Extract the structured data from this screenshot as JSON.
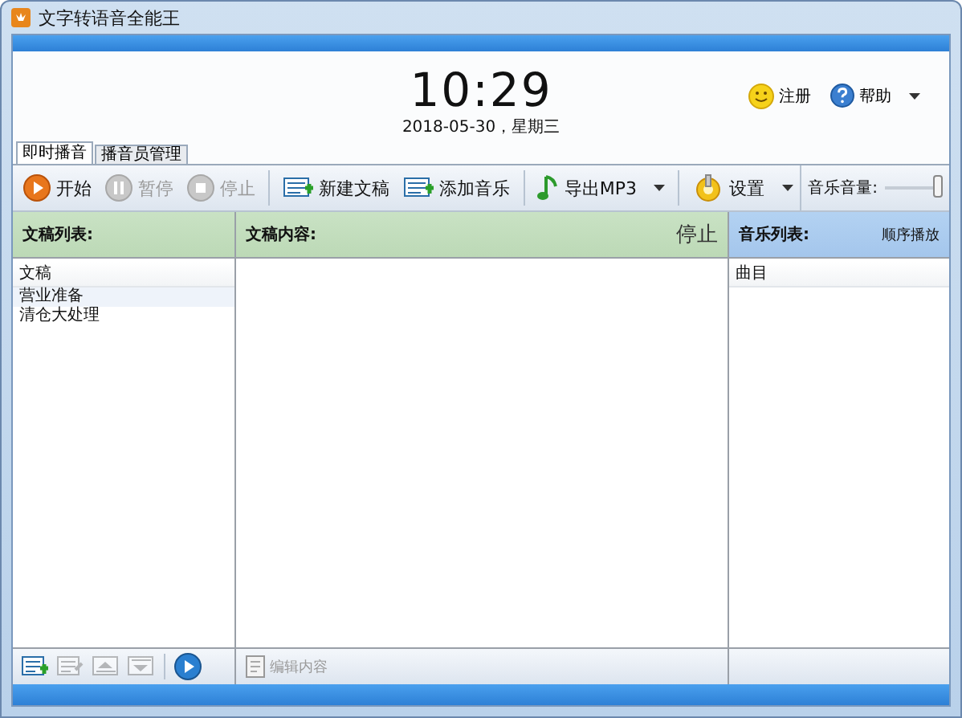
{
  "window": {
    "title": "文字转语音全能王"
  },
  "clock": {
    "time": "10:29",
    "date": "2018-05-30，星期三"
  },
  "header_links": [
    {
      "kind": "register",
      "label": "注册",
      "dropdown": false
    },
    {
      "kind": "help",
      "label": "帮助",
      "dropdown": true
    }
  ],
  "tabs": [
    {
      "label": "即时播音",
      "selected": true
    },
    {
      "label": "播音员管理",
      "selected": false
    }
  ],
  "toolbar": [
    {
      "kind": "play",
      "label": "开始",
      "disabled": false,
      "dropdown": false,
      "separator_before": false
    },
    {
      "kind": "pause",
      "label": "暂停",
      "disabled": true,
      "dropdown": false,
      "separator_before": false
    },
    {
      "kind": "stop",
      "label": "停止",
      "disabled": true,
      "dropdown": false,
      "separator_before": false
    },
    {
      "kind": "new-doc",
      "label": "新建文稿",
      "disabled": false,
      "dropdown": false,
      "separator_before": true
    },
    {
      "kind": "add-music",
      "label": "添加音乐",
      "disabled": false,
      "dropdown": false,
      "separator_before": false
    },
    {
      "kind": "export",
      "label": "导出MP3",
      "disabled": false,
      "dropdown": true,
      "separator_before": true
    },
    {
      "kind": "settings",
      "label": "设置",
      "disabled": false,
      "dropdown": true,
      "separator_before": true
    }
  ],
  "volume": {
    "label": "音乐音量:",
    "level": 1.0
  },
  "script_list": {
    "title": "文稿列表:",
    "column": "文稿",
    "items": [
      {
        "label": "营业准备",
        "selected": true
      },
      {
        "label": "清仓大处理",
        "selected": false
      }
    ]
  },
  "content": {
    "title": "文稿内容:",
    "status": "停止"
  },
  "music_list": {
    "title": "音乐列表:",
    "mode": "顺序播放",
    "column": "曲目"
  },
  "list_tools": [
    {
      "kind": "add",
      "disabled": false
    },
    {
      "kind": "edit",
      "disabled": true
    },
    {
      "kind": "up",
      "disabled": true
    },
    {
      "kind": "down",
      "disabled": true
    },
    {
      "kind": "play",
      "disabled": false
    }
  ],
  "edit_button": {
    "label": "编辑内容",
    "disabled": true
  }
}
